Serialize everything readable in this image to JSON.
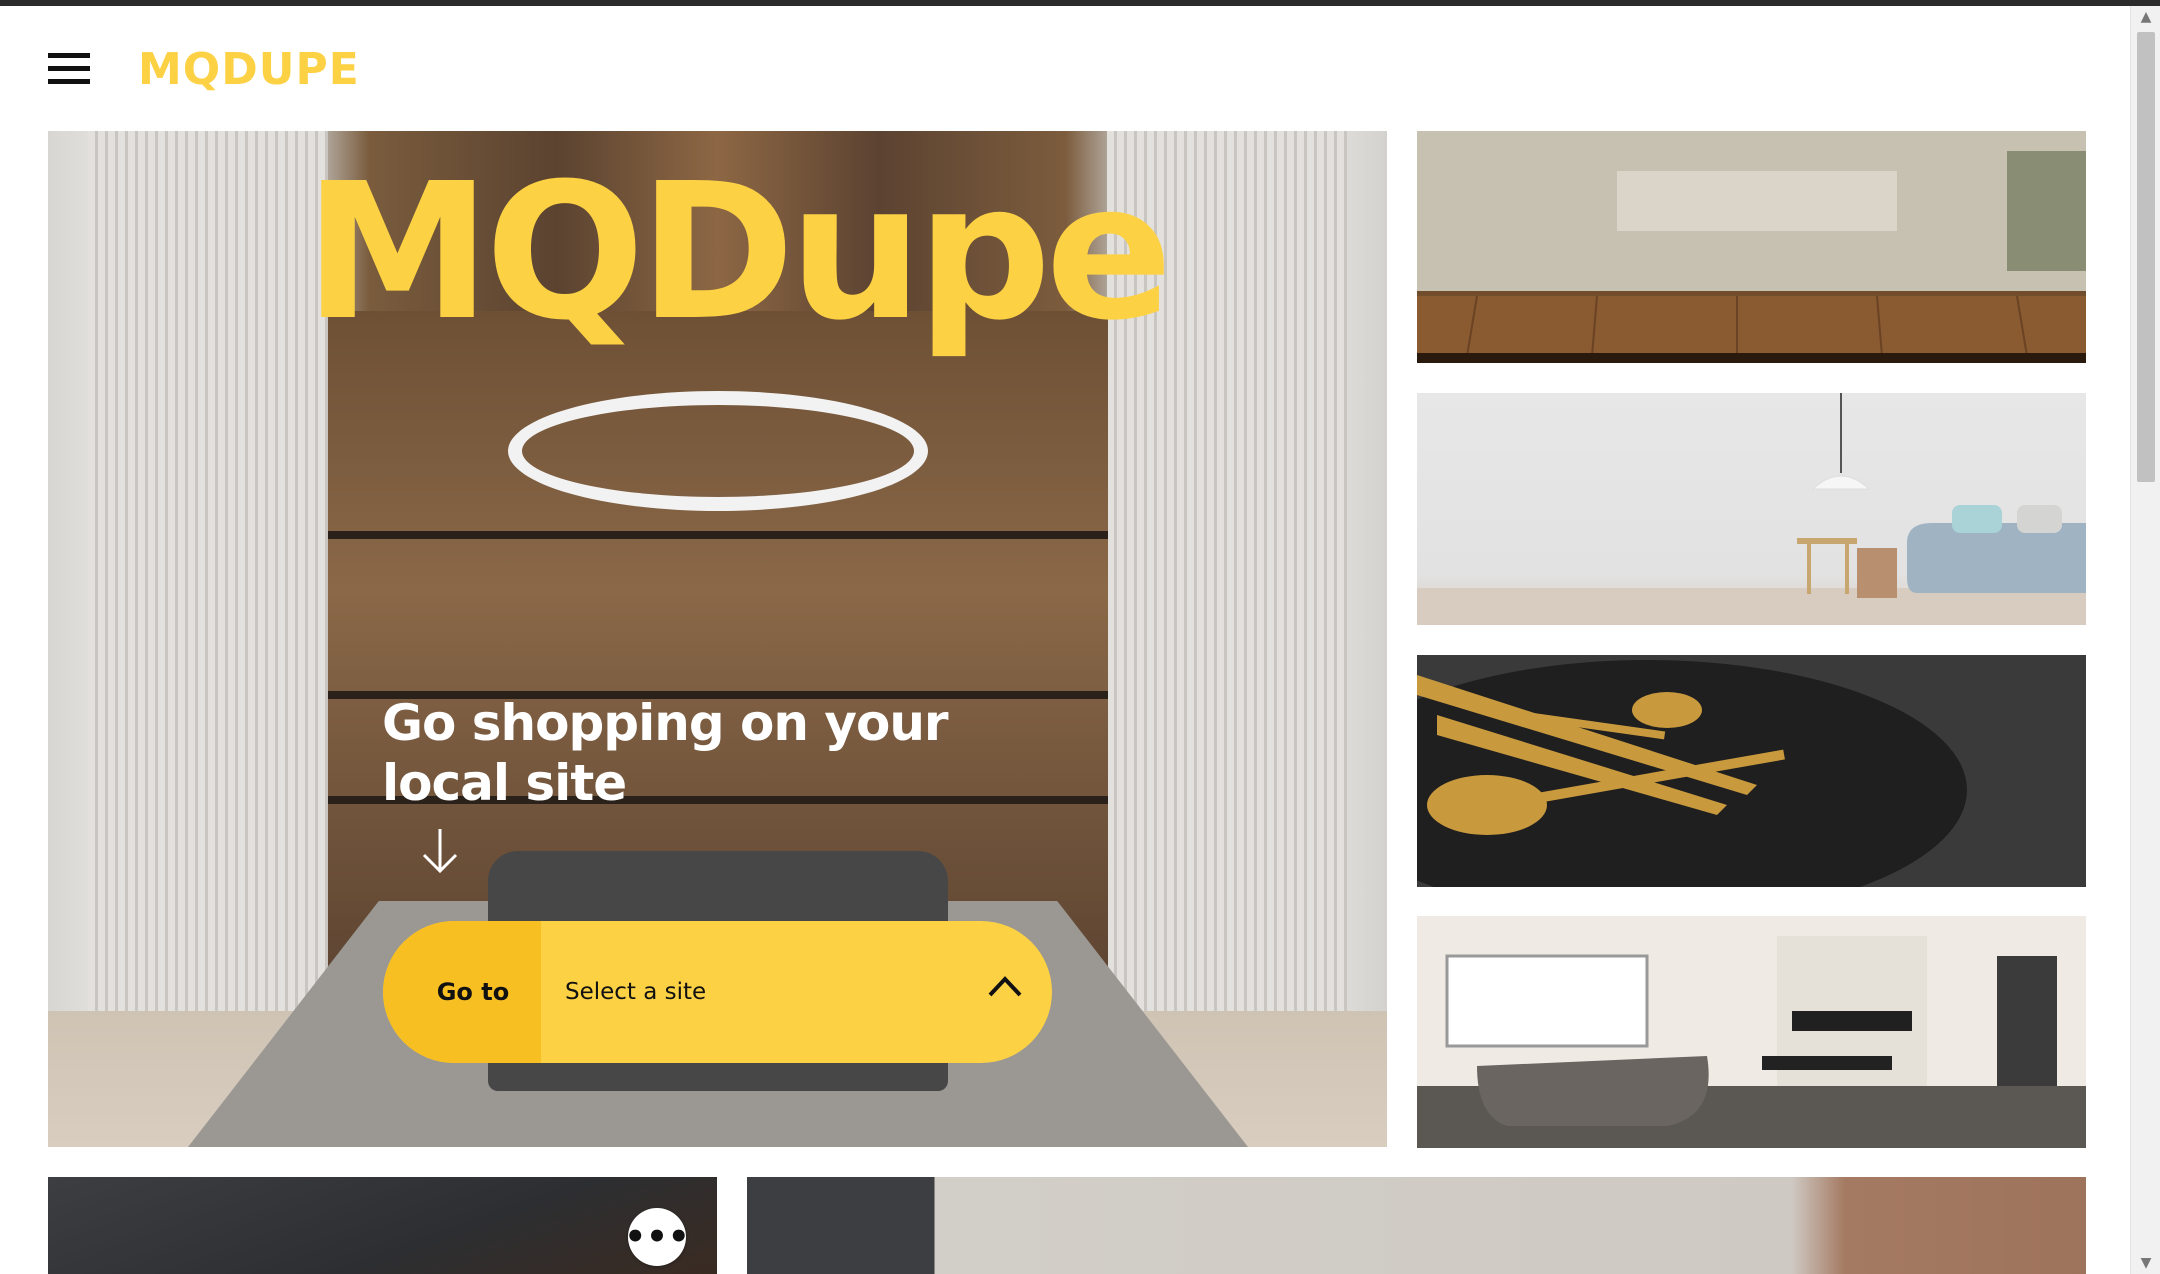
{
  "header": {
    "logo_text": "MQDUPE",
    "menu_icon": "hamburger-menu-icon"
  },
  "hero": {
    "title": "MQDupe",
    "subtitle": "Go shopping on your local site",
    "arrow_icon": "arrow-down-icon",
    "goto": {
      "button_label": "Go to",
      "select_label": "Select a site",
      "chevron_icon": "chevron-up-icon"
    }
  },
  "thumbnails": [
    {
      "name": "kitchen-wood-counter-image"
    },
    {
      "name": "living-room-sofa-image"
    },
    {
      "name": "gold-cutlery-plate-image"
    },
    {
      "name": "bathroom-bathtub-image"
    }
  ],
  "bottom": {
    "more_icon": "more-options-icon",
    "more_label": "•••"
  },
  "colors": {
    "brand_yellow": "#fcd144",
    "goto_button": "#f8bf22",
    "white_text": "#ffffff"
  }
}
